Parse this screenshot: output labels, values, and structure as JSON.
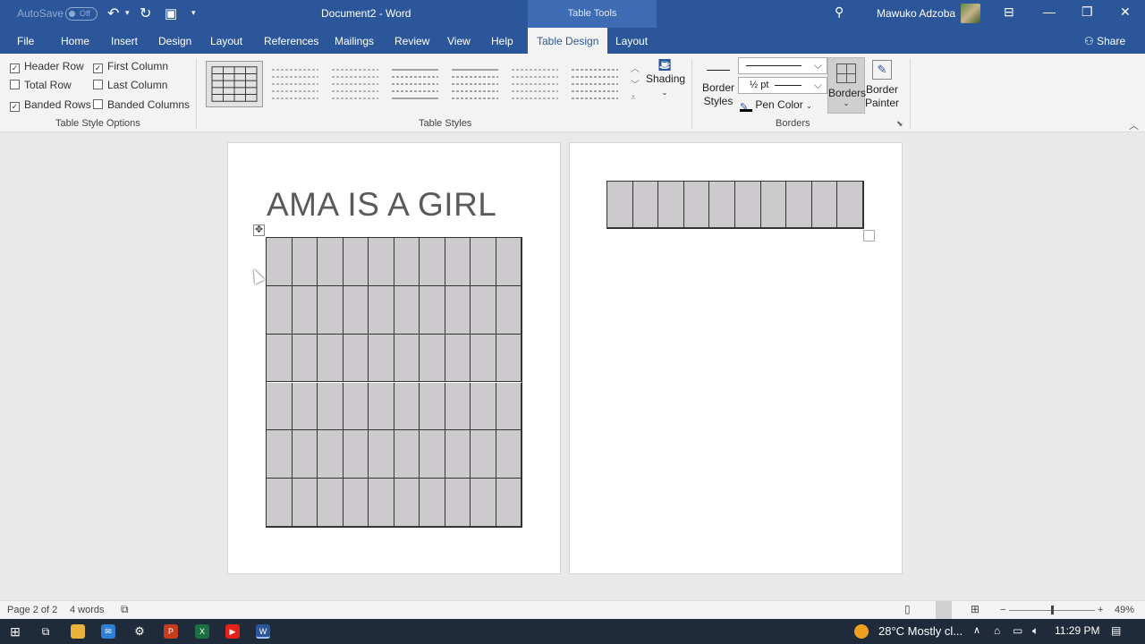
{
  "titlebar": {
    "autosave_label": "AutoSave",
    "autosave_state": "Off",
    "document_title": "Document2  -  Word",
    "table_tools": "Table Tools",
    "user_name": "Mawuko Adzoba"
  },
  "menu_tabs": [
    "File",
    "Home",
    "Insert",
    "Design",
    "Layout",
    "References",
    "Mailings",
    "Review",
    "View",
    "Help",
    "Table Design",
    "Layout"
  ],
  "active_tab": "Table Design",
  "share_label": "Share",
  "ribbon": {
    "table_style_options": {
      "group_label": "Table Style Options",
      "options": [
        {
          "label": "Header Row",
          "checked": true
        },
        {
          "label": "First Column",
          "checked": true
        },
        {
          "label": "Total Row",
          "checked": false
        },
        {
          "label": "Last Column",
          "checked": false
        },
        {
          "label": "Banded Rows",
          "checked": true
        },
        {
          "label": "Banded Columns",
          "checked": false
        }
      ]
    },
    "table_styles": {
      "group_label": "Table Styles",
      "shading_label": "Shading"
    },
    "borders": {
      "group_label": "Borders",
      "border_styles_label": "Border Styles",
      "pen_weight": "½ pt",
      "pen_color_label": "Pen Color",
      "borders_label": "Borders",
      "border_painter_label": "Border Painter"
    }
  },
  "document": {
    "heading": "AMA IS A GIRL",
    "table1": {
      "rows": 6,
      "cols": 10
    },
    "table2": {
      "rows": 1,
      "cols": 10
    }
  },
  "statusbar": {
    "page_info": "Page 2 of 2",
    "word_count": "4 words",
    "zoom": "49%"
  },
  "taskbar": {
    "weather": "28°C  Mostly cl...",
    "time": "11:29 PM"
  },
  "colors": {
    "brand": "#2b579a",
    "cell_shading": "#cdcacd"
  }
}
